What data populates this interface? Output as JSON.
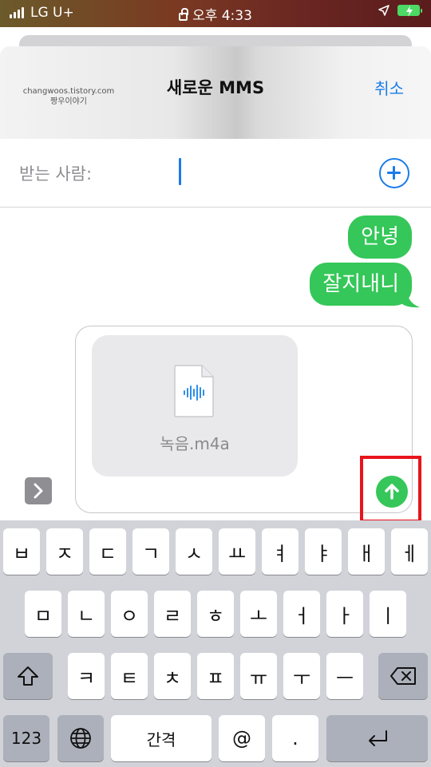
{
  "status_bar": {
    "carrier": "LG U+",
    "time": "오후 4:33"
  },
  "header": {
    "watermark_line1": "changwoos.tistory.com",
    "watermark_line2": "짱우이야기",
    "title": "새로운 MMS",
    "cancel_label": "취소"
  },
  "recipient": {
    "label": "받는 사람:",
    "value": ""
  },
  "messages": [
    {
      "text": "안녕"
    },
    {
      "text": "잘지내니"
    }
  ],
  "attachment": {
    "file_name": "녹음.m4a"
  },
  "colors": {
    "accent": "#1a7ce8",
    "bubble": "#35c759",
    "highlight": "#e8141b"
  },
  "keyboard": {
    "row1": [
      "ㅂ",
      "ㅈ",
      "ㄷ",
      "ㄱ",
      "ㅅ",
      "ㅛ",
      "ㅕ",
      "ㅑ",
      "ㅐ",
      "ㅔ"
    ],
    "row2": [
      "ㅁ",
      "ㄴ",
      "ㅇ",
      "ㄹ",
      "ㅎ",
      "ㅗ",
      "ㅓ",
      "ㅏ",
      "ㅣ"
    ],
    "row3": [
      "ㅋ",
      "ㅌ",
      "ㅊ",
      "ㅍ",
      "ㅠ",
      "ㅜ",
      "ㅡ"
    ],
    "numbers_label": "123",
    "space_label": "간격",
    "at_label": "@",
    "period_label": "."
  }
}
